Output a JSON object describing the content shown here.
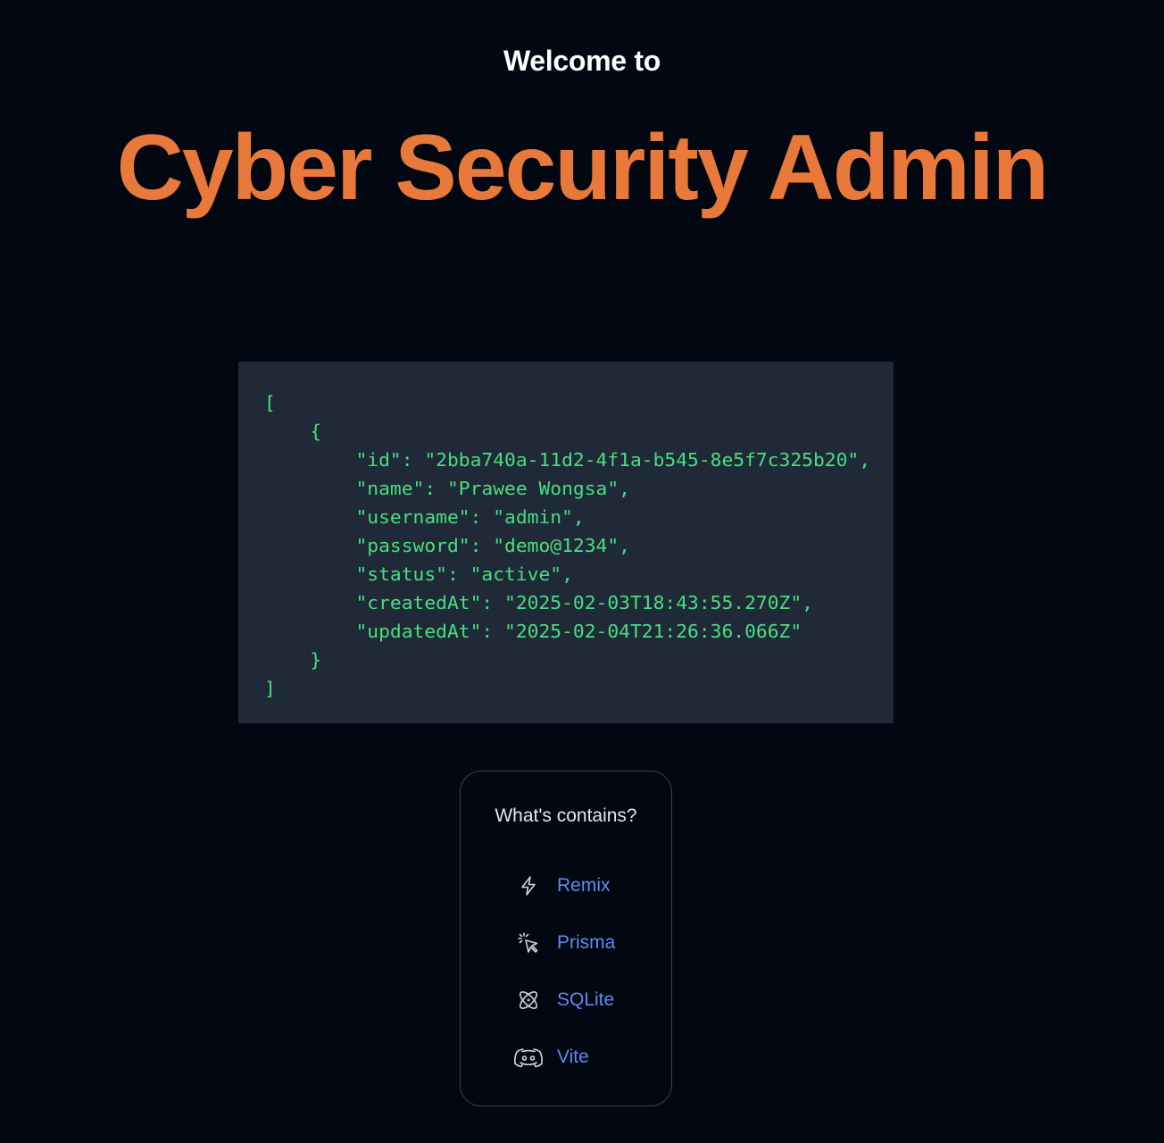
{
  "header": {
    "welcome": "Welcome to",
    "title": "Cyber Security Admin"
  },
  "json_output": "[\n    {\n        \"id\": \"2bba740a-11d2-4f1a-b545-8e5f7c325b20\",\n        \"name\": \"Prawee Wongsa\",\n        \"username\": \"admin\",\n        \"password\": \"demo@1234\",\n        \"status\": \"active\",\n        \"createdAt\": \"2025-02-03T18:43:55.270Z\",\n        \"updatedAt\": \"2025-02-04T21:26:36.066Z\"\n    }\n]",
  "contains": {
    "title": "What's contains?",
    "items": [
      {
        "label": "Remix",
        "icon": "lightning-icon"
      },
      {
        "label": "Prisma",
        "icon": "cursor-click-icon"
      },
      {
        "label": "SQLite",
        "icon": "atom-icon"
      },
      {
        "label": "Vite",
        "icon": "discord-icon"
      }
    ]
  },
  "colors": {
    "background": "#030712",
    "title_accent": "#e8793a",
    "code_text": "#4ade80",
    "code_background": "#1f2937",
    "link": "#5b8def"
  }
}
